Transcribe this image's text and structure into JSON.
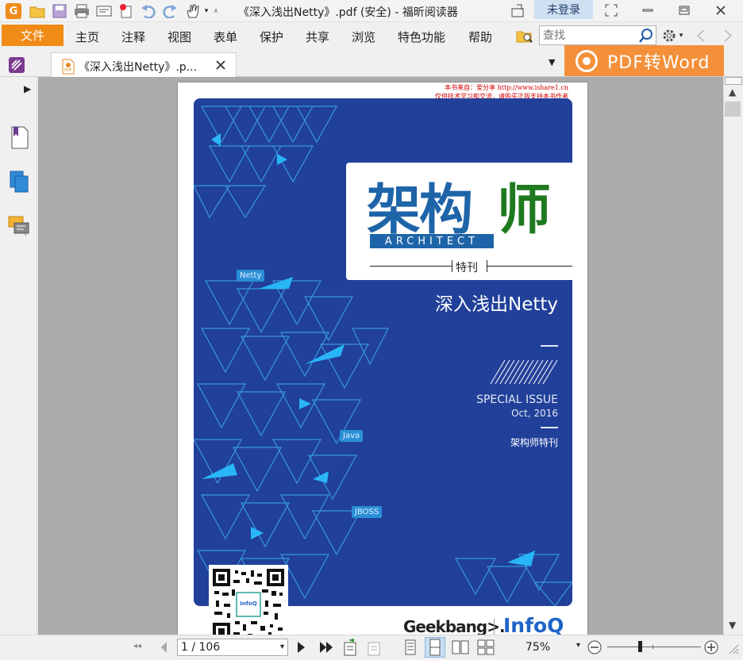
{
  "window": {
    "title": "《深入浅出Netty》.pdf (安全) - 福昕阅读器",
    "login": "未登录"
  },
  "menu": {
    "file": "文件",
    "items": [
      "主页",
      "注释",
      "视图",
      "表单",
      "保护",
      "共享",
      "浏览",
      "特色功能",
      "帮助"
    ]
  },
  "search": {
    "placeholder": "查找"
  },
  "tab": {
    "label": "《深入浅出Netty》.p..."
  },
  "convert": {
    "label": "PDF转Word"
  },
  "document": {
    "watermark_line1": "本书来自：爱分享 http://www.ishare1.cn",
    "watermark_line2": "仅供技术学习和交流，请购买正版支持本书作者",
    "cover": {
      "title_blue": "架构",
      "title_green": "师",
      "architect": "ARCHITECT",
      "tag": "特刊",
      "subtitle": "深入浅出Netty",
      "special_issue": "SPECIAL ISSUE",
      "date": "Oct, 2016",
      "foot": "架构师特刊",
      "bubbles": [
        "Netty",
        "Java",
        "JBOSS"
      ],
      "qr_label": "InfoQ",
      "logo_geek": "Geekbang>.",
      "logo_infoq": "InfoQ"
    }
  },
  "status": {
    "page": "1 / 106",
    "zoom": "75%"
  },
  "colors": {
    "accent": "#f08b16",
    "cover_blue": "#21409a",
    "title_blue": "#1e64a8",
    "title_green": "#1f7a1f",
    "watermark_red": "#d20000"
  },
  "icons": {
    "app": "foxit-logo-icon",
    "open": "open-folder-icon",
    "save": "save-icon",
    "print": "print-icon",
    "scan": "scanner-icon",
    "new": "new-icon",
    "undo": "undo-icon",
    "redo": "redo-icon",
    "hand": "hand-tool-icon"
  }
}
